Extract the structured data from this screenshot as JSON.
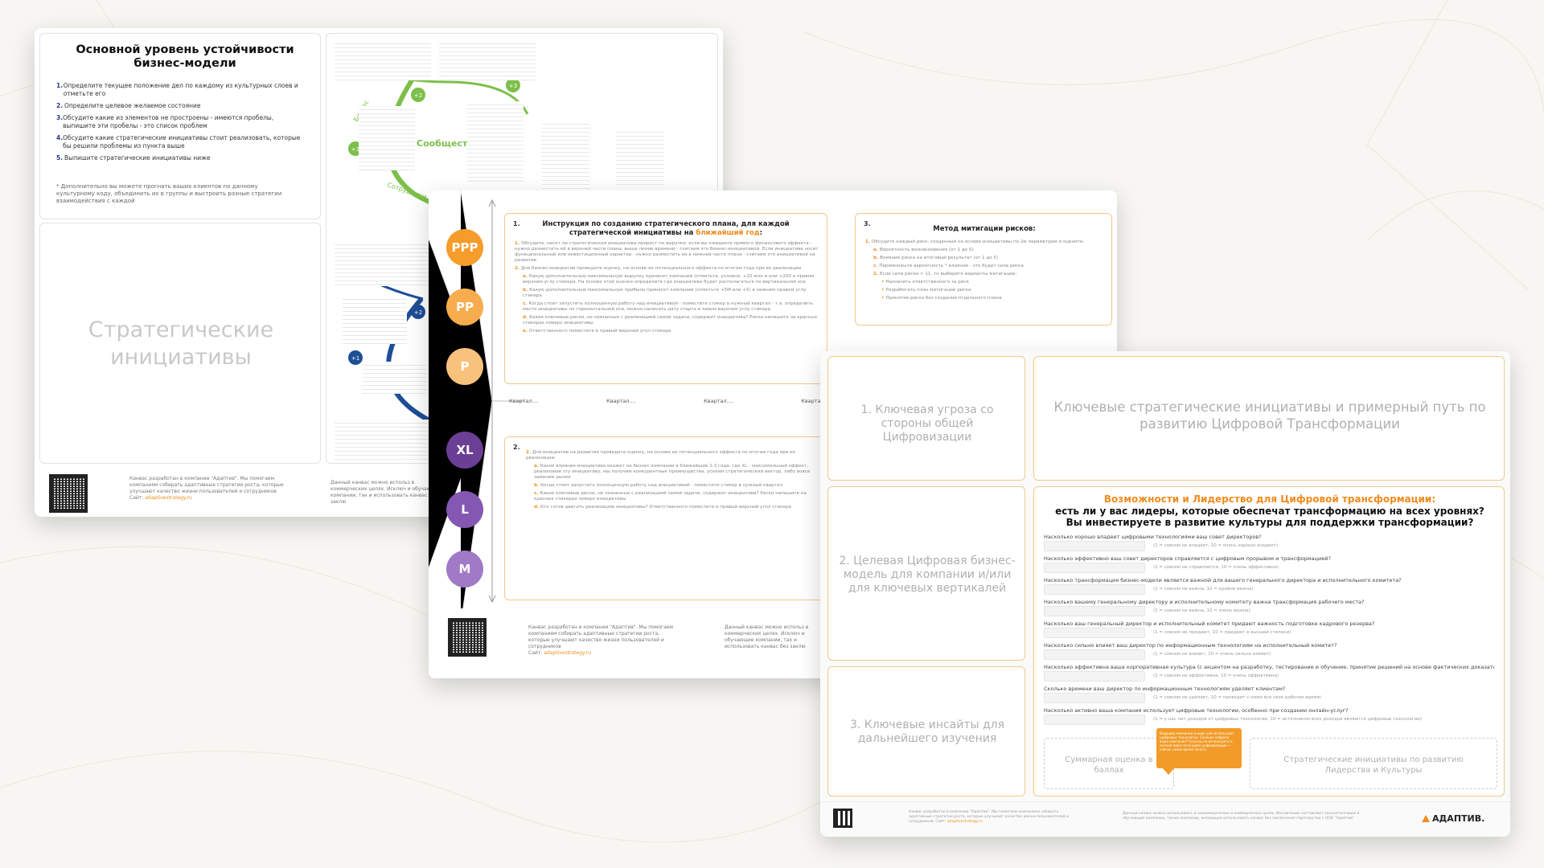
{
  "sheet1": {
    "title": "Основной уровень устойчивости бизнес-модели",
    "steps": [
      "Определите текущее положение дел по каждому из культурных слоев и отметьте его",
      "Определите целевое желаемое состояние",
      "Обсудите какие из элементов не простроены - имеются пробелы, выпишите эти пробелы - это список проблем",
      "Обсудите какие стратегические инициативы стоит реализовать, которые бы решили проблемы из пункта выше",
      "Выпишите стратегические инициативы ниже"
    ],
    "note": "* Дополнительно вы можете прогнать ваших клиентов по данному культурному коду, объединить их в группы и выстроить разные стратегии взаимодействия с каждой",
    "initiatives_label": "Стратегические инициативы",
    "community_label": "Сообщество",
    "arc_labels": [
      "Бизнес",
      "Сотрудники"
    ],
    "badges": [
      "+1",
      "+2",
      "+3"
    ],
    "footer_left": "Канвас разработан в компании \"Адаптив\". Мы помогаем компаниям собирать адаптивные стратегии роста, которые улучшают качество жизни пользователей и сотрудников",
    "site_prefix": "Сайт:",
    "site": "adaptivestrategy.ru",
    "footer_right": "Данный канвас можно использ в коммерческих целях. Исключ и обучающие компании, так и использовать канвас без заклю"
  },
  "sheet2": {
    "circles": [
      {
        "label": "PPP",
        "color": "#f59c2b"
      },
      {
        "label": "PP",
        "color": "#f7ad4e"
      },
      {
        "label": "P",
        "color": "#f9c27c"
      },
      {
        "label": "XL",
        "color": "#6b3f96"
      },
      {
        "label": "L",
        "color": "#8457b2"
      },
      {
        "label": "M",
        "color": "#a07ac6"
      }
    ],
    "block1_num": "1.",
    "block1_title": "Инструкция по созданию стратегического плана, для каждой стратегической инициативы на",
    "block1_title_hl": "ближайший год",
    "block1_title_end": ":",
    "block1_items": [
      "Обсудите, несет ли стратегическая инициатива прирост по выручке: если вы ожидаете прямого финансового эффекта - нужно разместить её в верхней части плана, выше линии времени - считаем это бизнес-инициативой. Если инициатива носит функциональный или инвестиционный характер - нужно разместить ее в нижней части плана - считаем это инициативой на развитие",
      "Для бизнес-инициатив проведите оценку, на основе ее потенциального эффекта по итогам года при ее реализации",
      "Какую дополнительную максимальную выручку принесет компании (отметьте, условно, +20 млн и или +200 в правом верхнем углу стикера. На основе этой оценки определите где инициатива будет располагаться по вертикальной оси",
      "Какую дополнительную максимальную прибыль принесет компании (отметьте +5М или +5) в нижнем правом углу стикера",
      "Когда стоит запустить полноценную работу над инициативой - поместите стикер в нужный квартал - т.е. определить место инициативы по горизонтальной оси, можно написать дату старта в левом верхнем углу стикера",
      "Какие ключевые риски, не связанные с реализацией самой задачи, содержит инициатива? Риски напишите на красных стикерах поверх инициативы",
      "Ответственного поместите в правый верхний угол стикера"
    ],
    "quarters": [
      "Квартал....",
      "Квартал....",
      "Квартал....",
      "Квартал...."
    ],
    "block2_num": "2.",
    "block2_items": [
      "Для инициатив на развитие проведите оценку, на основе ее потенциального эффекта по итогам года при ее реализации:",
      "Какое влияние инициатива окажет на бизнес компании в ближайшие 2-3 года: где XL - максимальный эффект, реализовав эту инициативу, мы получим конкурентные преимущества, усилим стратегический вектор, либо вовсе заменим рынок",
      "Когда стоит запустить полноценную работу над инициативой - поместите стикер в нужный квартал",
      "Какие ключевые риски, не связанные с реализацией самой задачи, содержит инициатива? Риски напишите на красных стикерах поверх инициативы",
      "Кто готов двигать реализацию инициативы? Ответственного поместите в правый верхний угол стикера"
    ],
    "block3_num": "3.",
    "block3_title": "Метод митигации рисков:",
    "block3_items": [
      "Обсудите каждый риск, созданный на основе инициативы по 2м параметрам и оцените:",
      "Вероятность возникновения (от 1 до 5)",
      "Влияние риска на итоговый результат (от 1 до 5)",
      "Перемножьте вероятность * влияние - это будет сила риска",
      "Если сила риска > 11, то выберите варианты митигации:",
      "Назначить ответственного за риск",
      "Разработать план митигации риска",
      "Принятие риска без создания отдельного плана"
    ],
    "footer_left": "Канвас разработан в компании \"Адаптив\". Мы помогаем компаниям собирать адаптивные стратегии роста, которые улучшают качество жизни пользователей и сотрудников",
    "site_prefix": "Сайт:",
    "site": "adaptivestrategy.ru",
    "footer_right": "Данный канвас можно использ в коммерческих целях. Исключ и обучающие компании, так и использовать канвас без заклю"
  },
  "sheet3": {
    "box1": "1. Ключевая угроза со стороны общей Цифровизации",
    "box2": "2. Целевая Цифровая бизнес-модель для компании и/или для ключевых вертикалей",
    "box3": "3. Ключевые инсайты для дальнейшего изучения",
    "box_top": "Ключевые стратегические инициативы и примерный путь по развитию Цифровой Трансформации",
    "survey_title_orange": "Возможности и Лидерство для Цифровой трансформации:",
    "survey_title_1": "есть ли у вас лидеры, которые обеспечат трансформацию на всех уровнях?",
    "survey_title_2": "Вы инвестируете в развитие культуры для поддержки трансформации?",
    "questions": [
      {
        "q": "Насколько хорошо владеет цифровыми технологиями ваш совет директоров?",
        "hint": "(1 = совсем не владеет, 10 = очень хорошо владеет)"
      },
      {
        "q": "Насколько эффективно ваш совет директоров справляется с цифровым прорывом и трансформацией?",
        "hint": "(1 = совсем не справляется, 10 = очень эффективно)"
      },
      {
        "q": "Насколько трансформация бизнес-модели является важной для вашего генерального директора и исполнительного комитета?",
        "hint": "(1 = совсем не важна, 10 = крайне важна)"
      },
      {
        "q": "Насколько вашему генеральному директору и исполнительному комитету важна трансформация рабочего места?",
        "hint": "(1 = совсем не важна, 10 = очень важна)"
      },
      {
        "q": "Насколько ваш генеральный директор и исполнительный комитет придают важность подготовке кадрового резерва?",
        "hint": "(1 = совсем не придают, 10 = придают в высшей степени)"
      },
      {
        "q": "Насколько сильно влияет ваш директор по информационным технологиям на исполнительный комитет?",
        "hint": "(1 = совсем не влияет, 10 = очень сильно влияет)"
      },
      {
        "q": "Насколько эффективна ваша корпоративная культура (с акцентом на разработку, тестирование и обучение, принятие решений на основе фактических доказательств, гибкое мышление, минимально жизнеспособные продукты) для извлечения максимума пользы из цифровых технологий?",
        "hint": "(1 = совсем не эффективна, 10 = очень эффективна)"
      },
      {
        "q": "Сколько времени ваш директор по информационным технологиям уделяет клиентам?",
        "hint": "(1 = совсем не уделяет, 10 = проводит с ними все свое рабочее время)"
      },
      {
        "q": "Насколько активно ваша компания использует цифровые технологии, особенно при создании онлайн-услуг?",
        "hint": "(1 = у нас нет доходов от цифровых технологий, 10 = источником всех доходов являются цифровые технологии)"
      }
    ],
    "score_label": "Суммарная оценка в баллах",
    "strategic_label": "Стратегические инициативы по развитию Лидерства и Культуры",
    "callout": "Ведущие компании в мире уже используют цифровые технологии. Сколько набрала ваша компания? Если вы не используете в полной мере потенциал цифровизации — сейчас самое время начать.",
    "footer_left": "Канвас разработан в компании \"Адаптив\". Мы помогаем компаниям собирать адаптивные стратегии роста, которые улучшают качество жизни пользователей и сотрудников. Сайт:",
    "site": "adaptivestrategy.ru",
    "footer_right": "Данный канвас можно использовать в некоммерческих и коммерческих целях. Исключение составляют консалтинговые и обучающие компании, также компании, желающие использовать канвас без заключения партнерства с ООО \"Адаптив\"",
    "logo": "АДАПТИВ."
  }
}
